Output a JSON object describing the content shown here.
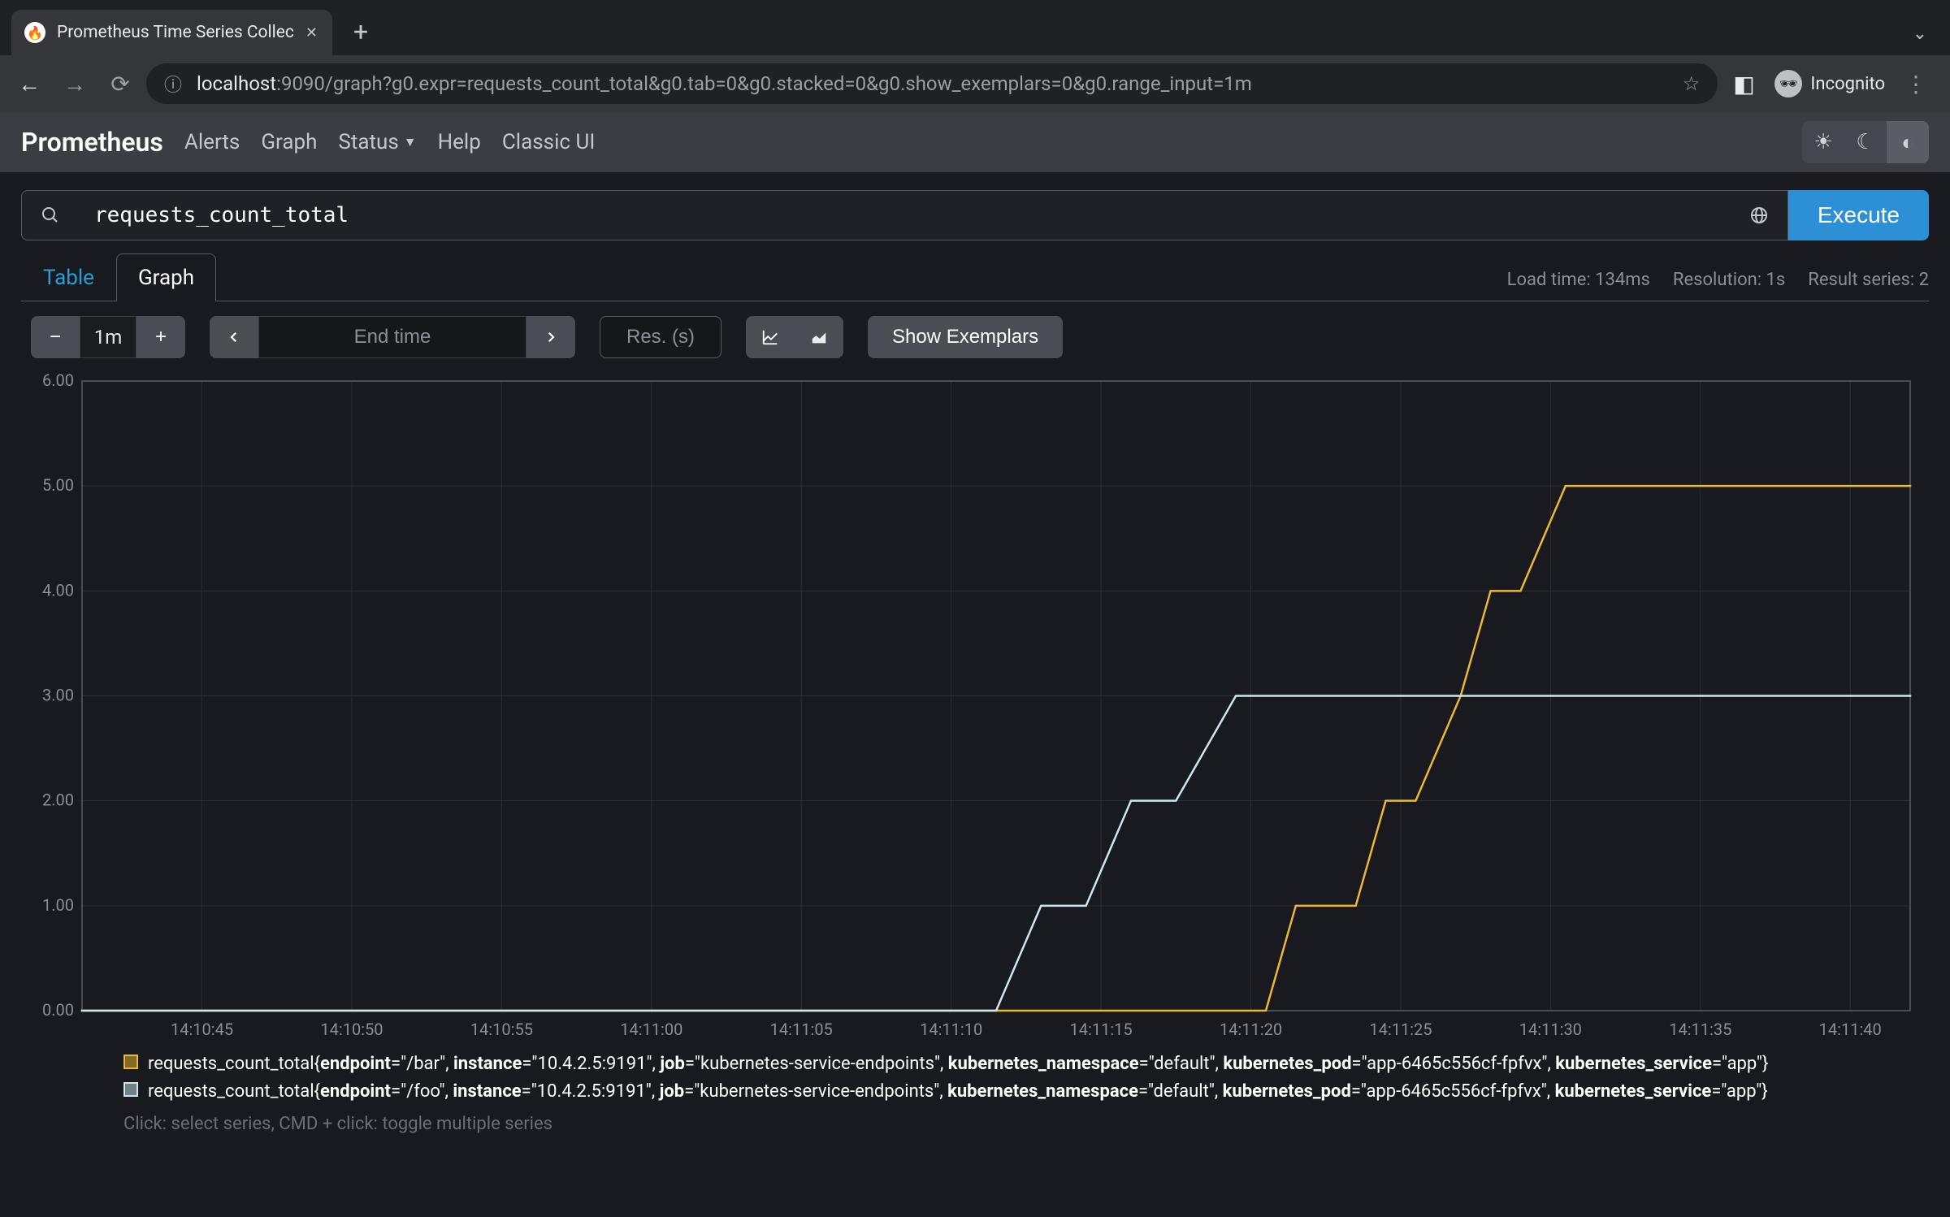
{
  "browser": {
    "tab_title": "Prometheus Time Series Collec",
    "url_host": "localhost",
    "url_rest": ":9090/graph?g0.expr=requests_count_total&g0.tab=0&g0.stacked=0&g0.show_exemplars=0&g0.range_input=1m",
    "incognito_label": "Incognito"
  },
  "nav": {
    "brand": "Prometheus",
    "links": [
      "Alerts",
      "Graph",
      "Status",
      "Help",
      "Classic UI"
    ]
  },
  "query": {
    "expression": "requests_count_total",
    "execute_label": "Execute"
  },
  "tabs": {
    "table": "Table",
    "graph": "Graph"
  },
  "stats": {
    "load_time": "Load time: 134ms",
    "resolution": "Resolution: 1s",
    "result_series": "Result series: 2"
  },
  "toolbar": {
    "range": "1m",
    "end_time_placeholder": "End time",
    "res_placeholder": "Res. (s)",
    "show_exemplars": "Show Exemplars"
  },
  "chart_data": {
    "type": "line",
    "ylim": [
      0,
      6
    ],
    "y_ticks": [
      0,
      1,
      2,
      3,
      4,
      5,
      6
    ],
    "y_tick_labels": [
      "0.00",
      "1.00",
      "2.00",
      "3.00",
      "4.00",
      "5.00",
      "6.00"
    ],
    "x_ticks_seconds": [
      45,
      50,
      55,
      60,
      65,
      70,
      75,
      80,
      85,
      90,
      95,
      100
    ],
    "x_tick_labels": [
      "14:10:45",
      "14:10:50",
      "14:10:55",
      "14:11:00",
      "14:11:05",
      "14:11:10",
      "14:11:15",
      "14:11:20",
      "14:11:25",
      "14:11:30",
      "14:11:35",
      "14:11:40"
    ],
    "x_range": [
      41,
      102
    ],
    "series": [
      {
        "name": "requests_count_total /bar",
        "color": "#edb735",
        "points": [
          {
            "t": 41,
            "v": 0
          },
          {
            "t": 80.5,
            "v": 0
          },
          {
            "t": 81.5,
            "v": 1
          },
          {
            "t": 83.5,
            "v": 1
          },
          {
            "t": 84.5,
            "v": 2
          },
          {
            "t": 85.5,
            "v": 2
          },
          {
            "t": 87,
            "v": 3
          },
          {
            "t": 88,
            "v": 4
          },
          {
            "t": 89,
            "v": 4
          },
          {
            "t": 90.5,
            "v": 5
          },
          {
            "t": 102,
            "v": 5
          }
        ]
      },
      {
        "name": "requests_count_total /foo",
        "color": "#cfe6f0",
        "points": [
          {
            "t": 41,
            "v": 0
          },
          {
            "t": 71.5,
            "v": 0
          },
          {
            "t": 73,
            "v": 1
          },
          {
            "t": 74.5,
            "v": 1
          },
          {
            "t": 76,
            "v": 2
          },
          {
            "t": 77.5,
            "v": 2
          },
          {
            "t": 79.5,
            "v": 3
          },
          {
            "t": 102,
            "v": 3
          }
        ]
      }
    ]
  },
  "legend": {
    "items": [
      {
        "metric": "requests_count_total",
        "labels": [
          {
            "k": "endpoint",
            "v": "\"/bar\""
          },
          {
            "k": "instance",
            "v": "\"10.4.2.5:9191\""
          },
          {
            "k": "job",
            "v": "\"kubernetes-service-endpoints\""
          },
          {
            "k": "kubernetes_namespace",
            "v": "\"default\""
          },
          {
            "k": "kubernetes_pod",
            "v": "\"app-6465c556cf-fpfvx\""
          },
          {
            "k": "kubernetes_service",
            "v": "\"app\""
          }
        ]
      },
      {
        "metric": "requests_count_total",
        "labels": [
          {
            "k": "endpoint",
            "v": "\"/foo\""
          },
          {
            "k": "instance",
            "v": "\"10.4.2.5:9191\""
          },
          {
            "k": "job",
            "v": "\"kubernetes-service-endpoints\""
          },
          {
            "k": "kubernetes_namespace",
            "v": "\"default\""
          },
          {
            "k": "kubernetes_pod",
            "v": "\"app-6465c556cf-fpfvx\""
          },
          {
            "k": "kubernetes_service",
            "v": "\"app\""
          }
        ]
      }
    ],
    "hint": "Click: select series, CMD + click: toggle multiple series"
  }
}
